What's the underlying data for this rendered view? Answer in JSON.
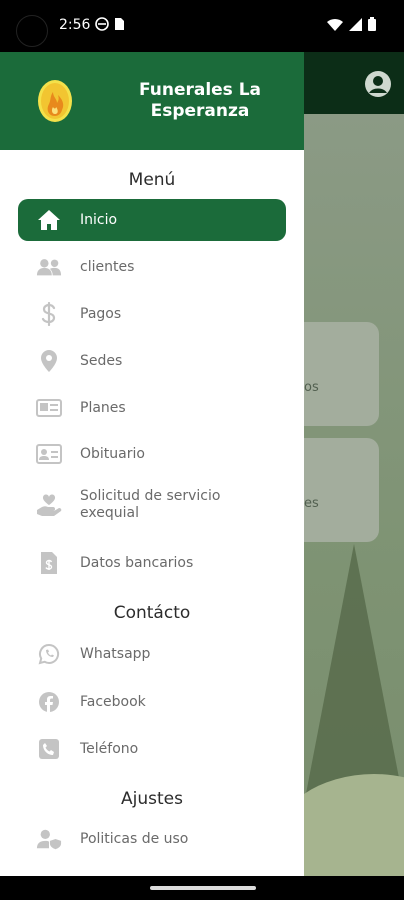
{
  "status_bar": {
    "time": "2:56",
    "icons_left": [
      "vpn-icon",
      "sim-icon"
    ],
    "icons_right": [
      "wifi-icon",
      "signal-icon",
      "battery-icon"
    ]
  },
  "drawer": {
    "brand": "Funerales La Esperanza",
    "brand_line1": "Funerales La",
    "brand_line2": "Esperanza",
    "sections": {
      "menu": "Menú",
      "contact": "Contácto",
      "settings": "Ajustes"
    },
    "menu_items": [
      {
        "label": "Inicio",
        "icon": "home-icon",
        "active": true
      },
      {
        "label": "clientes",
        "icon": "users-icon"
      },
      {
        "label": "Pagos",
        "icon": "dollar-icon"
      },
      {
        "label": "Sedes",
        "icon": "location-icon"
      },
      {
        "label": "Planes",
        "icon": "card-icon"
      },
      {
        "label": "Obituario",
        "icon": "id-card-icon"
      },
      {
        "label": "Solicitud de servicio exequial",
        "icon": "hand-heart-icon"
      },
      {
        "label": "Datos bancarios",
        "icon": "document-icon"
      }
    ],
    "contact_items": [
      {
        "label": "Whatsapp",
        "icon": "whatsapp-icon"
      },
      {
        "label": "Facebook",
        "icon": "facebook-icon"
      },
      {
        "label": "Teléfono",
        "icon": "phone-icon"
      }
    ],
    "settings_items": [
      {
        "label": "Politicas de uso",
        "icon": "user-shield-icon"
      }
    ]
  },
  "background": {
    "card1_text": "os",
    "card2_text": "es"
  },
  "colors": {
    "primary": "#1b6b3a",
    "icon": "#c4c4c4",
    "text": "#6a6a6a"
  }
}
